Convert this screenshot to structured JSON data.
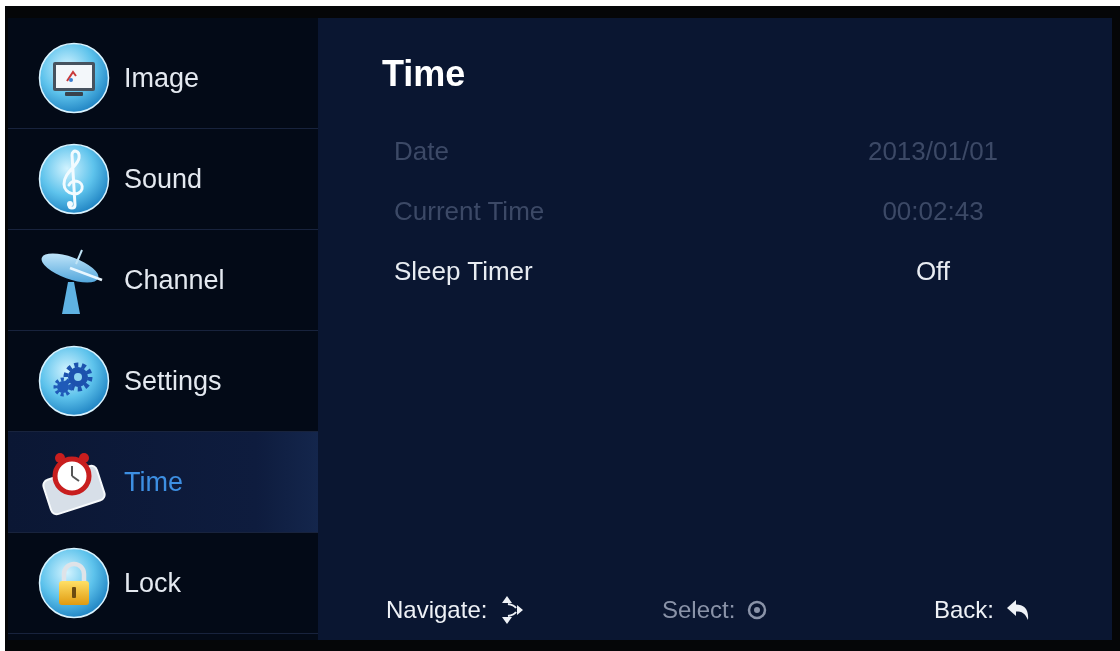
{
  "sidebar": {
    "items": [
      {
        "label": "Image",
        "selected": false
      },
      {
        "label": "Sound",
        "selected": false
      },
      {
        "label": "Channel",
        "selected": false
      },
      {
        "label": "Settings",
        "selected": false
      },
      {
        "label": "Time",
        "selected": true
      },
      {
        "label": "Lock",
        "selected": false
      }
    ]
  },
  "panel": {
    "title": "Time",
    "rows": [
      {
        "label": "Date",
        "value": "2013/01/01",
        "disabled": true
      },
      {
        "label": "Current Time",
        "value": "00:02:43",
        "disabled": true
      },
      {
        "label": "Sleep Timer",
        "value": "Off",
        "disabled": false
      }
    ]
  },
  "footer": {
    "hints": [
      {
        "label": "Navigate:",
        "disabled": false
      },
      {
        "label": "Select:",
        "disabled": true
      },
      {
        "label": "Back:",
        "disabled": false
      }
    ]
  }
}
